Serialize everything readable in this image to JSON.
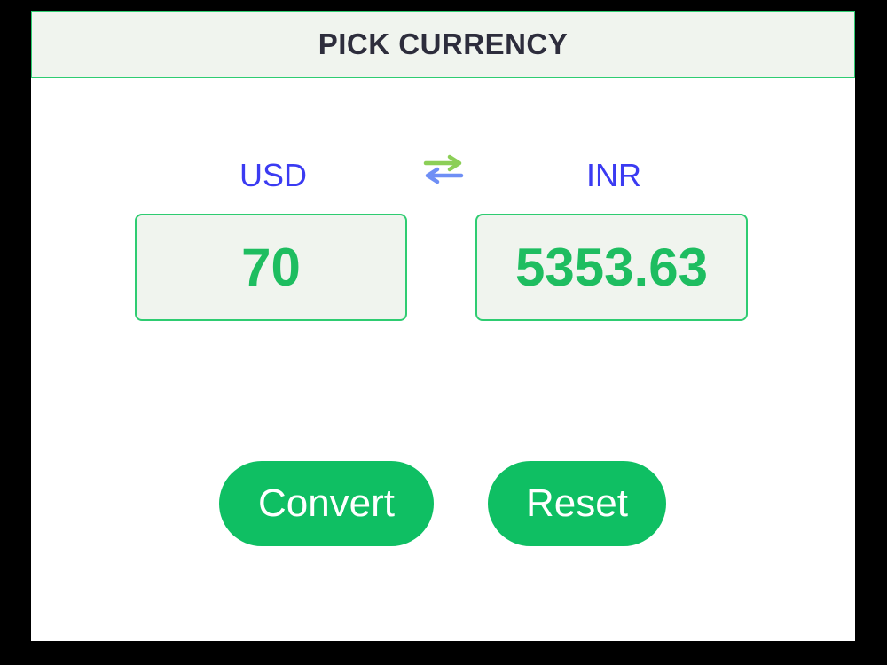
{
  "header": {
    "title": "PICK CURRENCY"
  },
  "converter": {
    "from_currency": "USD",
    "to_currency": "INR",
    "from_amount": "70",
    "to_amount": "5353.63"
  },
  "icons": {
    "swap": "swap-arrows-icon"
  },
  "buttons": {
    "convert_label": "Convert",
    "reset_label": "Reset"
  },
  "colors": {
    "accent_green": "#0fbf63",
    "label_blue": "#3b3bf2",
    "panel_bg": "#f0f4ee"
  }
}
